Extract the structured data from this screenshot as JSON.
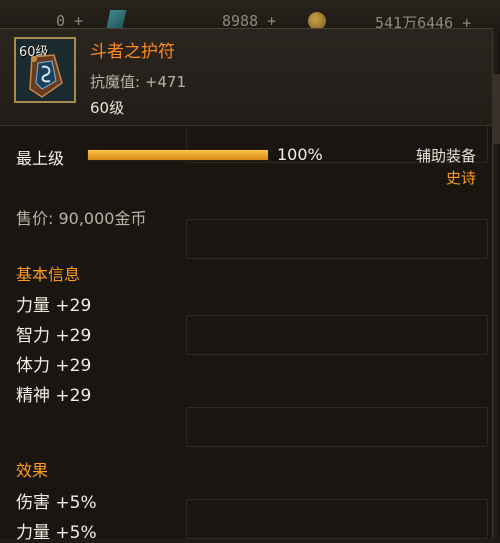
{
  "topbar": {
    "stamina": "0 +",
    "gold": "8988 +",
    "coins": "541万6446 +"
  },
  "item": {
    "icon_level": "60级",
    "name": "斗者之护符",
    "anti_magic": "抗魔值: +471",
    "required_level": "60级",
    "name_color": "#ff8a1e"
  },
  "enhancement": {
    "label": "最上级",
    "progress_percent": 100,
    "progress_text": "100%"
  },
  "equip_type": "辅助装备",
  "rarity": "史诗",
  "price": "售价: 90,000金币",
  "basic_info": {
    "title": "基本信息",
    "stats": [
      "力量 +29",
      "智力 +29",
      "体力 +29",
      "精神 +29"
    ]
  },
  "effects": {
    "title": "效果",
    "stats": [
      "伤害 +5%",
      "力量 +5%"
    ]
  }
}
